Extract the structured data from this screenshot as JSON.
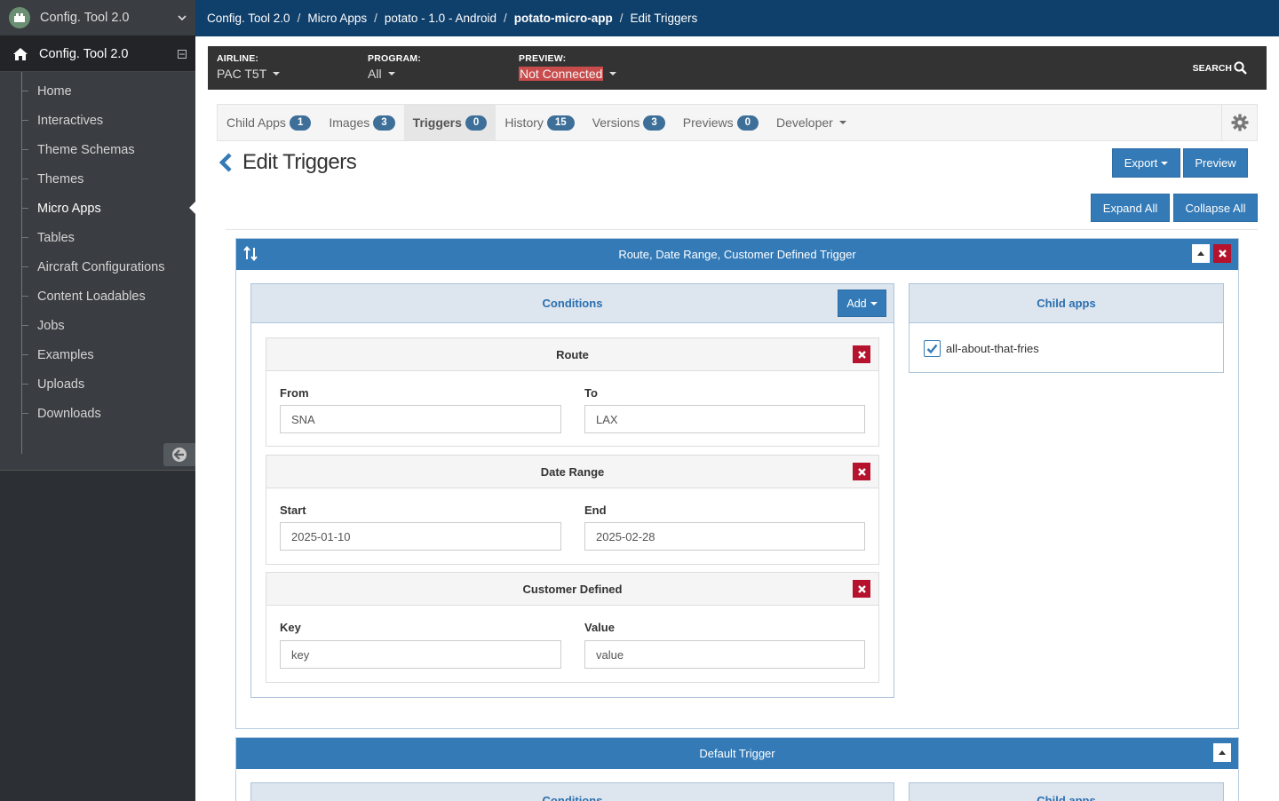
{
  "sidebar": {
    "app_switcher": "Config. Tool 2.0",
    "section_title": "Config. Tool 2.0",
    "items": [
      {
        "label": "Home"
      },
      {
        "label": "Interactives"
      },
      {
        "label": "Theme Schemas"
      },
      {
        "label": "Themes"
      },
      {
        "label": "Micro Apps"
      },
      {
        "label": "Tables"
      },
      {
        "label": "Aircraft Configurations"
      },
      {
        "label": "Content Loadables"
      },
      {
        "label": "Jobs"
      },
      {
        "label": "Examples"
      },
      {
        "label": "Uploads"
      },
      {
        "label": "Downloads"
      }
    ],
    "active_item": "Micro Apps"
  },
  "breadcrumb": [
    "Config. Tool 2.0",
    "Micro Apps",
    "potato - 1.0 - Android",
    "potato-micro-app",
    "Edit Triggers"
  ],
  "context_bar": {
    "airline_label": "AIRLINE:",
    "airline_value": "PAC T5T",
    "program_label": "PROGRAM:",
    "program_value": "All",
    "preview_label": "PREVIEW:",
    "preview_value": "Not Connected",
    "search_label": "SEARCH"
  },
  "tabs": [
    {
      "label": "Child Apps",
      "count": "1"
    },
    {
      "label": "Images",
      "count": "3"
    },
    {
      "label": "Triggers",
      "count": "0"
    },
    {
      "label": "History",
      "count": "15"
    },
    {
      "label": "Versions",
      "count": "3"
    },
    {
      "label": "Previews",
      "count": "0"
    },
    {
      "label": "Developer"
    }
  ],
  "active_tab": "Triggers",
  "page": {
    "title": "Edit Triggers",
    "export_label": "Export",
    "preview_label": "Preview",
    "expand_all_label": "Expand All",
    "collapse_all_label": "Collapse All"
  },
  "trigger1": {
    "title": "Route, Date Range, Customer Defined Trigger",
    "conditions_title": "Conditions",
    "add_label": "Add",
    "child_apps_title": "Child apps",
    "child_apps": [
      {
        "name": "all-about-that-fries",
        "checked": true
      }
    ],
    "route": {
      "title": "Route",
      "from_label": "From",
      "from_value": "SNA",
      "to_label": "To",
      "to_value": "LAX"
    },
    "date_range": {
      "title": "Date Range",
      "start_label": "Start",
      "start_value": "2025-01-10",
      "end_label": "End",
      "end_value": "2025-02-28"
    },
    "customer_defined": {
      "title": "Customer Defined",
      "key_label": "Key",
      "key_value": "key",
      "value_label": "Value",
      "value_value": "value"
    }
  },
  "trigger2": {
    "title": "Default Trigger",
    "conditions_title": "Conditions",
    "child_apps_title": "Child apps"
  },
  "colors": {
    "primary": "#337ab7",
    "danger": "#b5122d",
    "topbar": "#0f3f6b",
    "sidebar": "#2c2f33"
  }
}
